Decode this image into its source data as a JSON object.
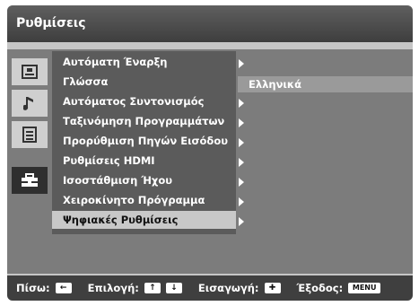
{
  "window": {
    "title": "Ρυθμίσεις"
  },
  "sidebar": {
    "items": [
      {
        "icon": "picture-icon"
      },
      {
        "icon": "music-note-icon"
      },
      {
        "icon": "list-icon"
      },
      {
        "icon": "toolbox-icon",
        "active": true
      }
    ]
  },
  "menu": {
    "items": [
      {
        "label": "Αυτόματη Έναρξη",
        "has_arrow": true
      },
      {
        "label": "Γλώσσα",
        "has_arrow": false
      },
      {
        "label": "Αυτόματος Συντονισμός",
        "has_arrow": true
      },
      {
        "label": "Ταξινόμηση Προγραμμάτων",
        "has_arrow": true
      },
      {
        "label": "Προρύθμιση Πηγών Εισόδου",
        "has_arrow": true
      },
      {
        "label": "Ρυθμίσεις HDMI",
        "has_arrow": true
      },
      {
        "label": "Ισοστάθμιση Ήχου",
        "has_arrow": true
      },
      {
        "label": "Χειροκίνητο Πρόγραμμα",
        "has_arrow": true
      },
      {
        "label": "Ψηφιακές Ρυθμίσεις",
        "has_arrow": true,
        "selected": true
      }
    ],
    "language_value": "Ελληνικά"
  },
  "footer": {
    "back_label": "Πίσω:",
    "select_label": "Επιλογή:",
    "enter_label": "Εισαγωγή:",
    "exit_label": "Έξοδος:",
    "menu_key_label": "MENU",
    "back_key_glyph": "←",
    "select_key_up_glyph": "↑",
    "select_key_down_glyph": "↓",
    "enter_key_glyph": "✚"
  }
}
